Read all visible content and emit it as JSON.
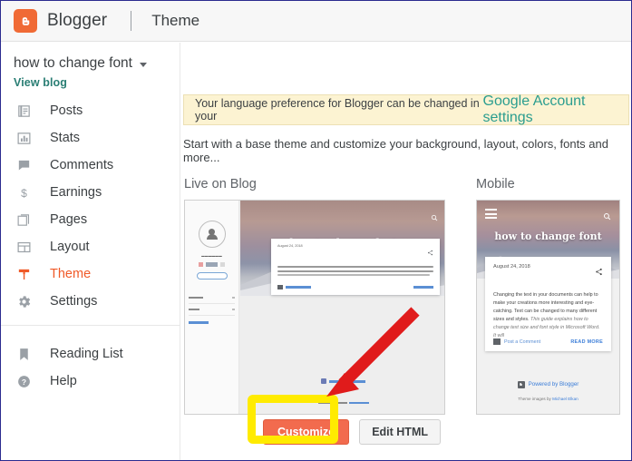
{
  "topbar": {
    "brand": "Blogger",
    "section_title": "Theme",
    "logo_icon": "blogger-logo-icon",
    "logo_color": "#f06a35"
  },
  "sidebar": {
    "blog_name": "how to change font",
    "blog_dropdown_icon": "chevron-down-icon",
    "view_blog": "View blog",
    "view_blog_color": "#2a7e74",
    "active_item": "Theme",
    "active_color": "#f05a28",
    "items": [
      {
        "label": "Posts",
        "icon": "posts-icon"
      },
      {
        "label": "Stats",
        "icon": "bar-chart-icon"
      },
      {
        "label": "Comments",
        "icon": "comment-bubble-icon"
      },
      {
        "label": "Earnings",
        "icon": "dollar-icon"
      },
      {
        "label": "Pages",
        "icon": "pages-icon"
      },
      {
        "label": "Layout",
        "icon": "layout-icon"
      },
      {
        "label": "Theme",
        "icon": "theme-brush-icon"
      },
      {
        "label": "Settings",
        "icon": "gear-icon"
      }
    ],
    "secondary_items": [
      {
        "label": "Reading List",
        "icon": "bookmark-icon"
      },
      {
        "label": "Help",
        "icon": "help-circle-icon"
      }
    ]
  },
  "notice": {
    "text_before": "Your language preference for Blogger can be changed in your ",
    "link": "Google Account settings",
    "bg": "#fcf3d2",
    "link_color": "#2a9d8f"
  },
  "main": {
    "subtitle": "Start with a base theme and customize your background, layout, colors, fonts and more...",
    "previews": {
      "desktop_heading": "Live on Blog",
      "mobile_heading": "Mobile"
    },
    "buttons": {
      "customize": "Customize",
      "customize_color": "#f26b4e",
      "edit_html": "Edit HTML"
    }
  },
  "blog_preview": {
    "title": "how to change font",
    "post_date": "August 24, 2018",
    "post_body": "Changing the text in your documents can help to make your creations more interesting and eye-catching. Text can be changed to many different sizes and styles.",
    "post_body_italic": " This guide explains how to change text size and font style in Microsoft Word. It will",
    "post_ellipsis": "...",
    "comment_label": "Post a Comment",
    "read_more": "READ MORE",
    "footer_powered": "Powered by Blogger",
    "footer_credit_before": "Theme images by ",
    "footer_credit_author": "Michael Elkan",
    "search_icon": "search-icon",
    "share_icon": "share-icon",
    "menu_icon": "hamburger-menu-icon",
    "avatar_icon": "avatar-icon"
  },
  "annotations": {
    "arrow": "red-arrow-pointing-to-customize",
    "arrow_color": "#e01b1b",
    "highlight": "yellow-highlight-around-customize",
    "highlight_color": "#ffeb00"
  }
}
